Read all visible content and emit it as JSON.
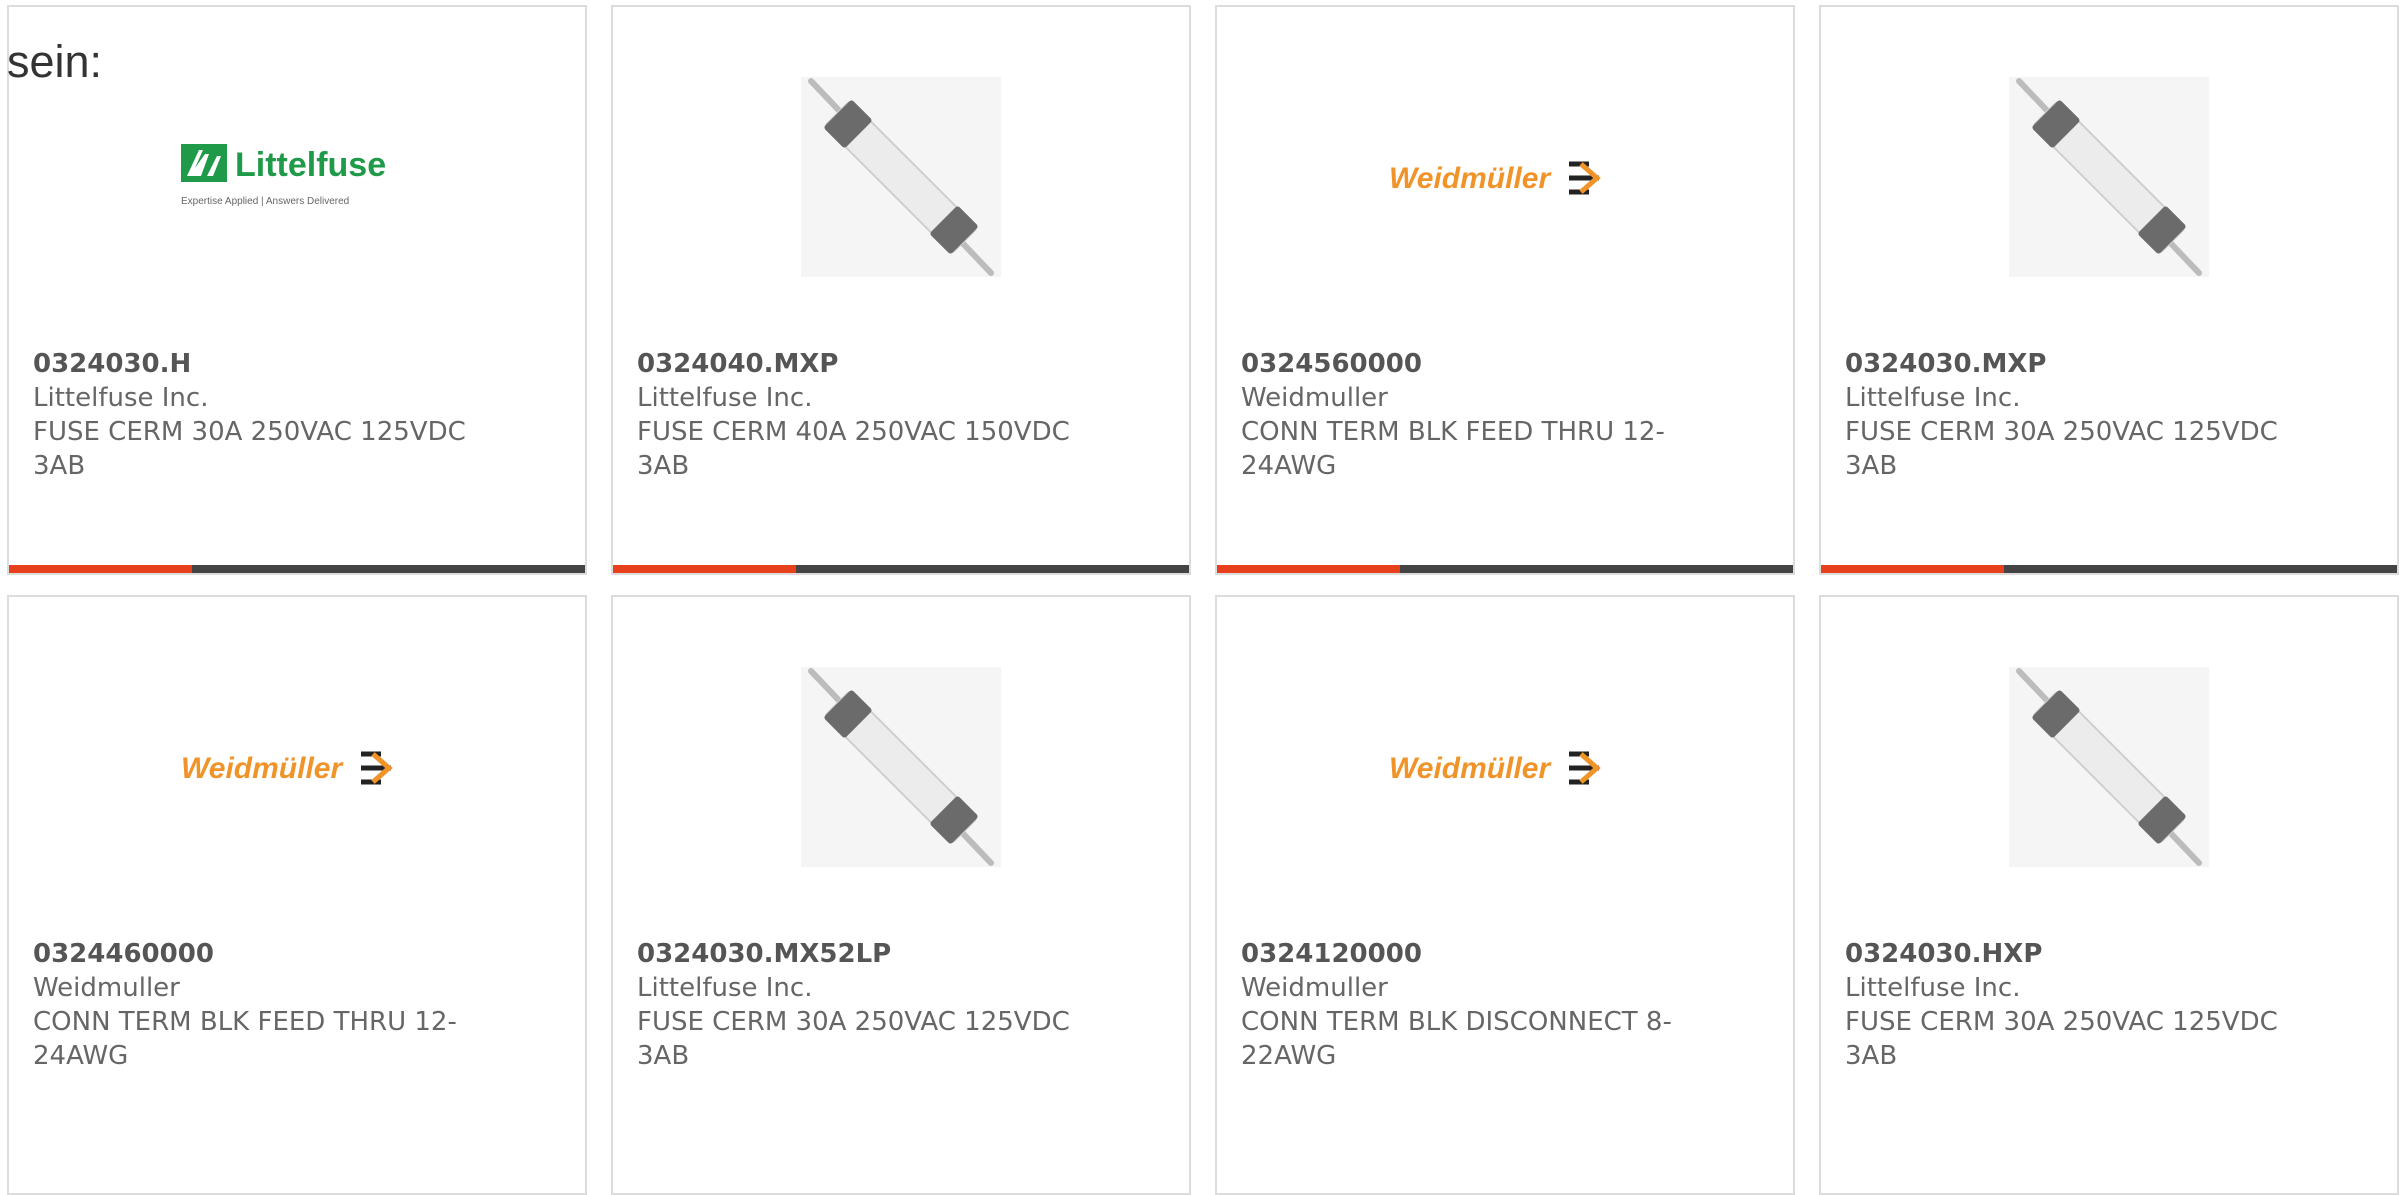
{
  "lead_text": "sein:",
  "colors": {
    "accent": "#e8401c",
    "bar": "#444444",
    "border": "#dcdcdc",
    "text": "#666666",
    "weidmuller_orange": "#f0942a",
    "littelfuse_green": "#1f9a48"
  },
  "logos": {
    "littelfuse_name": "Littelfuse",
    "littelfuse_tagline": "Expertise Applied | Answers Delivered",
    "weidmuller_name": "Weidmüller"
  },
  "products": [
    {
      "part": "0324030.H",
      "maker": "Littelfuse Inc.",
      "desc_line1": "FUSE CERM 30A 250VAC 125VDC",
      "desc_line2": "3AB",
      "image": "littelfuse-logo",
      "accent_visible": true
    },
    {
      "part": "0324040.MXP",
      "maker": "Littelfuse Inc.",
      "desc_line1": "FUSE CERM 40A 250VAC 150VDC",
      "desc_line2": "3AB",
      "image": "fuse-photo",
      "accent_visible": true
    },
    {
      "part": "0324560000",
      "maker": "Weidmuller",
      "desc_line1": "CONN TERM BLK FEED THRU 12-",
      "desc_line2": "24AWG",
      "image": "weidmuller-logo",
      "accent_visible": true
    },
    {
      "part": "0324030.MXP",
      "maker": "Littelfuse Inc.",
      "desc_line1": "FUSE CERM 30A 250VAC 125VDC",
      "desc_line2": "3AB",
      "image": "fuse-photo",
      "accent_visible": true
    },
    {
      "part": "0324460000",
      "maker": "Weidmuller",
      "desc_line1": "CONN TERM BLK FEED THRU 12-",
      "desc_line2": "24AWG",
      "image": "weidmuller-logo",
      "accent_visible": false
    },
    {
      "part": "0324030.MX52LP",
      "maker": "Littelfuse Inc.",
      "desc_line1": "FUSE CERM 30A 250VAC 125VDC",
      "desc_line2": "3AB",
      "image": "fuse-photo",
      "accent_visible": false
    },
    {
      "part": "0324120000",
      "maker": "Weidmuller",
      "desc_line1": "CONN TERM BLK DISCONNECT 8-",
      "desc_line2": "22AWG",
      "image": "weidmuller-logo",
      "accent_visible": false
    },
    {
      "part": "0324030.HXP",
      "maker": "Littelfuse Inc.",
      "desc_line1": "FUSE CERM 30A 250VAC 125VDC",
      "desc_line2": "3AB",
      "image": "fuse-photo",
      "accent_visible": false
    }
  ]
}
